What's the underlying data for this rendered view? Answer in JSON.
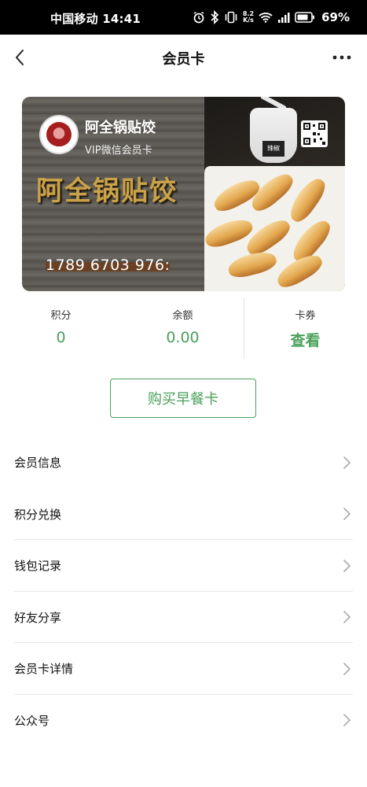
{
  "status_bar": {
    "carrier_time": "中国移动 14:41",
    "net_speed_value": "8.2",
    "net_speed_unit": "K/s",
    "battery_percent": "69%",
    "icons": [
      "alarm-icon",
      "bluetooth-icon",
      "vibrate-icon",
      "wifi-icon",
      "signal-icon",
      "battery-icon"
    ]
  },
  "nav": {
    "title": "会员卡",
    "back_icon": "chevron-left-icon",
    "more_icon": "more-dots-icon"
  },
  "card": {
    "store_name": "阿全锅贴饺",
    "card_type": "VIP微信会员卡",
    "big_title": "阿全锅贴饺",
    "number": "1789 6703 976:",
    "bowl_label": "辣椒"
  },
  "stats": [
    {
      "label": "积分",
      "value": "0"
    },
    {
      "label": "余额",
      "value": "0.00"
    },
    {
      "label": "卡券",
      "value": "查看"
    }
  ],
  "buy_button": "购买早餐卡",
  "menu": [
    {
      "label": "会员信息"
    },
    {
      "label": "积分兑换"
    },
    {
      "label": "钱包记录"
    },
    {
      "label": "好友分享"
    },
    {
      "label": "会员卡详情"
    },
    {
      "label": "公众号"
    }
  ],
  "colors": {
    "accent_green": "#4aa05a",
    "status_bar_bg": "#000000"
  }
}
